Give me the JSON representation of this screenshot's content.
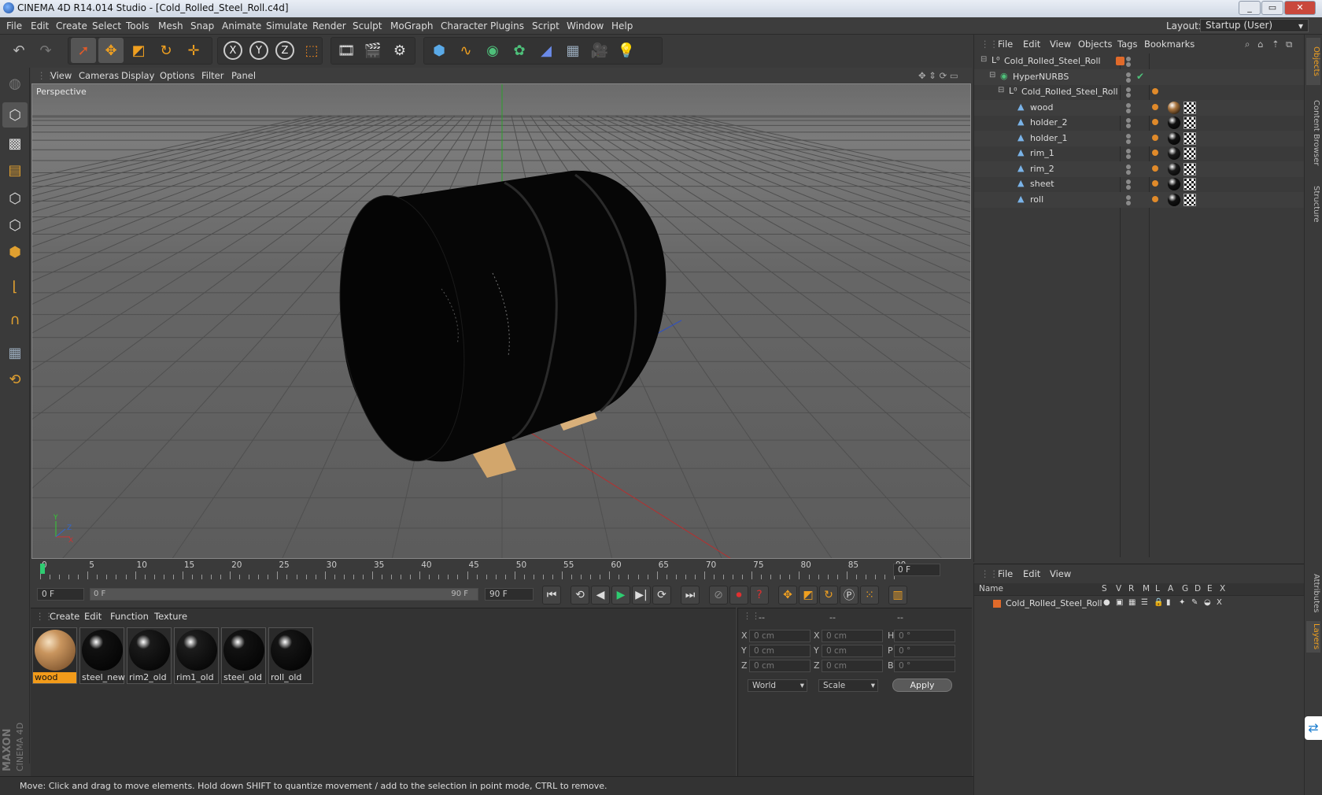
{
  "window": {
    "title": "CINEMA 4D R14.014 Studio - [Cold_Rolled_Steel_Roll.c4d]",
    "controls": [
      "_",
      "▭",
      "✕"
    ]
  },
  "menu": [
    "File",
    "Edit",
    "Create",
    "Select",
    "Tools",
    "Mesh",
    "Snap",
    "Animate",
    "Simulate",
    "Render",
    "Sculpt",
    "MoGraph",
    "Character",
    "Plugins",
    "Script",
    "Window",
    "Help"
  ],
  "layout": {
    "label": "Layout:",
    "value": "Startup (User)"
  },
  "toolbar": {
    "undo": "undo-icon",
    "redo": "redo-icon",
    "tools": [
      "select-arrow-icon",
      "move-icon",
      "scale-icon",
      "rotate-icon",
      "live-selection-icon"
    ],
    "axes": [
      "X",
      "Y",
      "Z"
    ],
    "coord_system": "world-coord-icon",
    "render": [
      "render-view-icon",
      "render-picture-viewer-icon",
      "render-settings-icon"
    ],
    "create": [
      "cube-icon",
      "spline-icon",
      "nurbs-icon",
      "mograph-cloner-icon",
      "deformer-icon",
      "scene-floor-icon",
      "camera-icon",
      "light-icon"
    ]
  },
  "viewport": {
    "menu": [
      "View",
      "Cameras",
      "Display",
      "Options",
      "Filter",
      "Panel"
    ],
    "label": "Perspective",
    "axis_labels": {
      "y": "Y",
      "z": "Z",
      "x": "X"
    }
  },
  "timeline": {
    "ticks": [
      "0",
      "5",
      "10",
      "15",
      "20",
      "25",
      "30",
      "35",
      "40",
      "45",
      "50",
      "55",
      "60",
      "65",
      "70",
      "75",
      "80",
      "85",
      "90"
    ],
    "current_frame": "0 F",
    "start_field": "0 F",
    "range_start": "0 F",
    "range_end": "90 F",
    "end_field": "90 F"
  },
  "materials": {
    "menu": [
      "Create",
      "Edit",
      "Function",
      "Texture"
    ],
    "items": [
      {
        "name": "wood",
        "selected": true,
        "color": "#c9955e"
      },
      {
        "name": "steel_new",
        "selected": false,
        "color": "#111111"
      },
      {
        "name": "rim2_old",
        "selected": false,
        "color": "#1a1a1a"
      },
      {
        "name": "rim1_old",
        "selected": false,
        "color": "#1c1c1c"
      },
      {
        "name": "steel_old",
        "selected": false,
        "color": "#121212"
      },
      {
        "name": "roll_old",
        "selected": false,
        "color": "#141414"
      }
    ]
  },
  "coordinates": {
    "headers": [
      "--",
      "--",
      "--"
    ],
    "rows": [
      {
        "a": "X",
        "av": "0 cm",
        "b": "X",
        "bv": "0 cm",
        "c": "H",
        "cv": "0 °"
      },
      {
        "a": "Y",
        "av": "0 cm",
        "b": "Y",
        "bv": "0 cm",
        "c": "P",
        "cv": "0 °"
      },
      {
        "a": "Z",
        "av": "0 cm",
        "b": "Z",
        "bv": "0 cm",
        "c": "B",
        "cv": "0 °"
      }
    ],
    "mode": "World",
    "scale": "Scale",
    "apply": "Apply"
  },
  "objects": {
    "menu": [
      "File",
      "Edit",
      "View",
      "Objects",
      "Tags",
      "Bookmarks"
    ],
    "tree": [
      {
        "name": "Cold_Rolled_Steel_Roll",
        "depth": 0,
        "type": "null"
      },
      {
        "name": "HyperNURBS",
        "depth": 1,
        "type": "hypernurbs"
      },
      {
        "name": "Cold_Rolled_Steel_Roll",
        "depth": 2,
        "type": "null"
      },
      {
        "name": "wood",
        "depth": 3,
        "type": "poly",
        "mat": "#a8743e"
      },
      {
        "name": "holder_2",
        "depth": 3,
        "type": "poly",
        "mat": "#111111"
      },
      {
        "name": "holder_1",
        "depth": 3,
        "type": "poly",
        "mat": "#111111"
      },
      {
        "name": "rim_1",
        "depth": 3,
        "type": "poly",
        "mat": "#1a1a1a"
      },
      {
        "name": "rim_2",
        "depth": 3,
        "type": "poly",
        "mat": "#1a1a1a"
      },
      {
        "name": "sheet",
        "depth": 3,
        "type": "poly",
        "mat": "#111111"
      },
      {
        "name": "roll",
        "depth": 3,
        "type": "poly",
        "mat": "#111111"
      }
    ]
  },
  "layers": {
    "menu": [
      "File",
      "Edit",
      "View"
    ],
    "headers": [
      "Name",
      "S",
      "V",
      "R",
      "M",
      "L",
      "A",
      "G",
      "D",
      "E",
      "X"
    ],
    "rows": [
      {
        "name": "Cold_Rolled_Steel_Roll",
        "color": "#e06a2a"
      }
    ]
  },
  "sidetabs": [
    "Objects",
    "Content Browser",
    "Structure",
    "Attributes",
    "Layers"
  ],
  "status": "Move: Click and drag to move elements. Hold down SHIFT to quantize movement / add to the selection in point mode, CTRL to remove.",
  "brand": {
    "line1": "MAXON",
    "line2": "CINEMA 4D"
  },
  "colors": {
    "accent": "#f29b1a",
    "bg": "#3a3a3a",
    "active_frame": "#2ecc71"
  }
}
